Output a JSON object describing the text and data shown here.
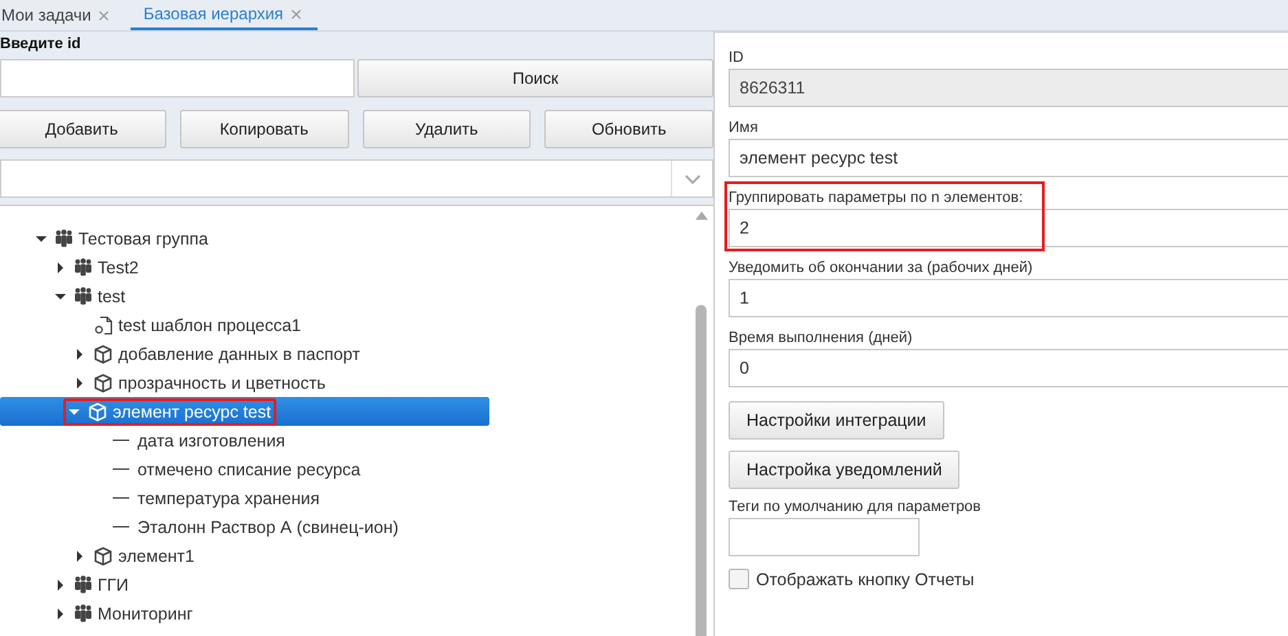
{
  "tabs": [
    {
      "label": "Мои задачи",
      "selected": false
    },
    {
      "label": "Базовая иерархия",
      "selected": true
    }
  ],
  "search": {
    "label": "Введите id",
    "button": "Поиск"
  },
  "actions": [
    "Добавить",
    "Копировать",
    "Удалить",
    "Обновить"
  ],
  "tree": [
    {
      "kind": "group",
      "label": "Тестовая группа",
      "expanded": true,
      "selected": false,
      "highlighted": false,
      "children": [
        {
          "kind": "group",
          "label": "Test2",
          "expanded": false,
          "selected": false,
          "highlighted": false
        },
        {
          "kind": "group",
          "label": "test",
          "expanded": true,
          "selected": false,
          "highlighted": false,
          "children": [
            {
              "kind": "template",
              "label": "test шаблон процесса1",
              "selected": false,
              "highlighted": false
            },
            {
              "kind": "element",
              "label": "добавление данных в паспорт",
              "expanded": false,
              "selected": false,
              "highlighted": false
            },
            {
              "kind": "element",
              "label": "прозрачность и цветность",
              "expanded": false,
              "selected": false,
              "highlighted": false
            },
            {
              "kind": "element",
              "label": "элемент ресурс test",
              "expanded": true,
              "selected": true,
              "highlighted": true,
              "children": [
                {
                  "kind": "param",
                  "label": "дата изготовления",
                  "selected": false,
                  "highlighted": false
                },
                {
                  "kind": "param",
                  "label": "отмечено списание ресурса",
                  "selected": false,
                  "highlighted": false
                },
                {
                  "kind": "param",
                  "label": "температура хранения",
                  "selected": false,
                  "highlighted": false
                },
                {
                  "kind": "param",
                  "label": "Эталонн Раствор А (свинец-ион)",
                  "selected": false,
                  "highlighted": false
                }
              ]
            },
            {
              "kind": "element",
              "label": "элемент1",
              "expanded": false,
              "selected": false,
              "highlighted": false
            }
          ]
        },
        {
          "kind": "group",
          "label": "ГГИ",
          "expanded": false,
          "selected": false,
          "highlighted": false
        },
        {
          "kind": "group",
          "label": "Мониторинг",
          "expanded": false,
          "selected": false,
          "highlighted": false
        }
      ]
    }
  ],
  "form": [
    {
      "kind": "field",
      "label": "ID",
      "value": "8626311",
      "readonly": true,
      "highlighted": false
    },
    {
      "kind": "field",
      "label": "Имя",
      "value": "элемент ресурс test",
      "readonly": false,
      "highlighted": false
    },
    {
      "kind": "field",
      "label": "Группировать параметры по n элементов:",
      "value": "2",
      "readonly": false,
      "highlighted": true
    },
    {
      "kind": "field",
      "label": "Уведомить об окончании за (рабочих дней)",
      "value": "1",
      "readonly": false,
      "highlighted": false
    },
    {
      "kind": "field",
      "label": "Время выполнения (дней)",
      "value": "0",
      "readonly": false,
      "highlighted": false
    },
    {
      "kind": "button",
      "label": "Настройки интеграции"
    },
    {
      "kind": "button",
      "label": "Настройка уведомлений"
    },
    {
      "kind": "shortfield",
      "label": "Теги по умолчанию для параметров",
      "readonly": false,
      "highlighted": false
    },
    {
      "kind": "checkbox",
      "label": "Отображать кнопку Отчеты",
      "checked": false
    }
  ]
}
